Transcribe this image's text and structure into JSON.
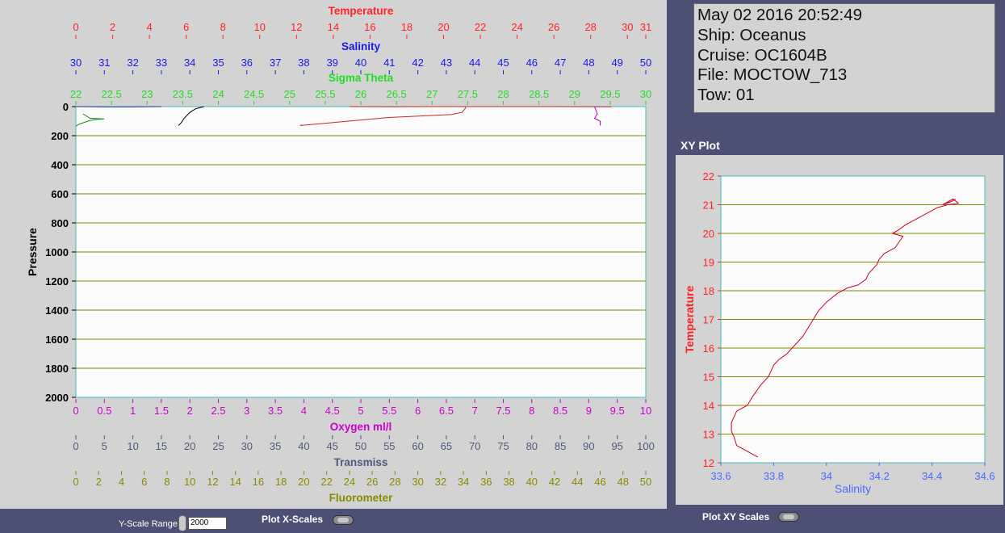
{
  "info": {
    "datetime": "May 02 2016 20:52:49",
    "ship": "Ship: Oceanus",
    "cruise": "Cruise: OC1604B",
    "file": "File: MOCTOW_713",
    "tow": "Tow: 01"
  },
  "xy_title": "XY Plot",
  "bottom": {
    "yscale_label": "Y-Scale Range",
    "yscale_value": "2000",
    "plot_xscales_label": "Plot X-Scales",
    "plot_xyscales_label": "Plot XY Scales"
  },
  "colors": {
    "temperature": "#ff2222",
    "salinity": "#1a1ae6",
    "sigma_theta": "#22dd22",
    "oxygen": "#cc00cc",
    "transmiss": "#505a78",
    "fluorometer": "#8a8a00",
    "xy_line": "#cc0022",
    "xy_salinity": "#4a6aff"
  },
  "chart_data": [
    {
      "type": "line",
      "ylabel": "Pressure",
      "ylim": [
        2000,
        0
      ],
      "yticks": [
        "0",
        "200",
        "400",
        "600",
        "800",
        "1000",
        "1200",
        "1400",
        "1600",
        "1800",
        "2000"
      ],
      "grid": true,
      "axes": {
        "temperature": {
          "label": "Temperature",
          "range": [
            0,
            31
          ],
          "ticks": [
            "0",
            "2",
            "4",
            "6",
            "8",
            "10",
            "12",
            "14",
            "16",
            "18",
            "20",
            "22",
            "24",
            "26",
            "28",
            "30",
            "31"
          ],
          "tick_values": [
            0,
            2,
            4,
            6,
            8,
            10,
            12,
            14,
            16,
            18,
            20,
            22,
            24,
            26,
            28,
            30,
            31
          ]
        },
        "salinity": {
          "label": "Salinity",
          "range": [
            30,
            50
          ],
          "ticks": [
            "30",
            "31",
            "32",
            "33",
            "34",
            "35",
            "36",
            "37",
            "38",
            "39",
            "40",
            "41",
            "42",
            "43",
            "44",
            "45",
            "46",
            "47",
            "48",
            "49",
            "50"
          ]
        },
        "sigma_theta": {
          "label": "Sigma Theta",
          "range": [
            22,
            30
          ],
          "ticks": [
            "22",
            "22.5",
            "23",
            "23.5",
            "24",
            "24.5",
            "25",
            "25.5",
            "26",
            "26.5",
            "27",
            "27.5",
            "28",
            "28.5",
            "29",
            "29.5",
            "30"
          ]
        },
        "oxygen": {
          "label": "Oxygen ml/l",
          "range": [
            0,
            10
          ],
          "ticks": [
            "0",
            "0.5",
            "1",
            "1.5",
            "2",
            "2.5",
            "3",
            "3.5",
            "4",
            "4.5",
            "5",
            "5.5",
            "6",
            "6.5",
            "7",
            "7.5",
            "8",
            "8.5",
            "9",
            "9.5",
            "10"
          ]
        },
        "transmiss": {
          "label": "Transmiss",
          "range": [
            0,
            100
          ],
          "ticks": [
            "0",
            "5",
            "10",
            "15",
            "20",
            "25",
            "30",
            "35",
            "40",
            "45",
            "50",
            "55",
            "60",
            "65",
            "70",
            "75",
            "80",
            "85",
            "90",
            "95",
            "100"
          ]
        },
        "fluorometer": {
          "label": "Fluorometer",
          "range": [
            0,
            50
          ],
          "ticks": [
            "0",
            "2",
            "4",
            "6",
            "8",
            "10",
            "12",
            "14",
            "16",
            "18",
            "20",
            "22",
            "24",
            "26",
            "28",
            "30",
            "32",
            "34",
            "36",
            "38",
            "40",
            "42",
            "44",
            "46",
            "48",
            "50"
          ]
        }
      },
      "series": [
        {
          "axis": "temperature",
          "points": [
            [
              21.2,
              0
            ],
            [
              21.2,
              10
            ],
            [
              21.0,
              40
            ],
            [
              20.4,
              55
            ],
            [
              17,
              75
            ],
            [
              12.2,
              130
            ],
            [
              12.3,
              126
            ]
          ]
        },
        {
          "axis": "salinity",
          "points": [
            [
              34.5,
              0
            ],
            [
              34.4,
              5
            ],
            [
              34.2,
              15
            ],
            [
              34.0,
              40
            ],
            [
              33.8,
              80
            ],
            [
              33.7,
              110
            ],
            [
              33.6,
              130
            ]
          ]
        },
        {
          "axis": "sigma_theta",
          "points": [
            [
              22.1,
              50
            ],
            [
              22.2,
              80
            ],
            [
              22.4,
              85
            ],
            [
              22.3,
              88
            ],
            [
              22.2,
              95
            ],
            [
              22.05,
              120
            ],
            [
              22.0,
              135
            ]
          ]
        },
        {
          "axis": "oxygen",
          "points": [
            [
              9.1,
              0
            ],
            [
              9.15,
              50
            ],
            [
              9.1,
              80
            ],
            [
              9.2,
              100
            ],
            [
              9.2,
              130
            ]
          ]
        },
        {
          "axis": "transmiss",
          "points": [
            [
              0,
              0
            ],
            [
              5,
              2
            ],
            [
              10,
              2
            ],
            [
              15,
              0
            ]
          ]
        },
        {
          "axis": "fluorometer",
          "points": [
            [
              24,
              0
            ],
            [
              28,
              1
            ],
            [
              30,
              0
            ],
            [
              38,
              0
            ],
            [
              42,
              0
            ],
            [
              47,
              1
            ]
          ]
        }
      ]
    },
    {
      "type": "line",
      "title": "XY Plot",
      "xlabel": "Salinity",
      "ylabel": "Temperature",
      "xlim": [
        33.6,
        34.6
      ],
      "ylim": [
        12,
        22
      ],
      "xticks": [
        "33.6",
        "33.8",
        "34",
        "34.2",
        "34.4",
        "34.6"
      ],
      "yticks": [
        "12",
        "13",
        "14",
        "15",
        "16",
        "17",
        "18",
        "19",
        "20",
        "21",
        "22"
      ],
      "grid": true,
      "x": [
        33.74,
        33.7,
        33.66,
        33.65,
        33.64,
        33.64,
        33.65,
        33.66,
        33.7,
        33.72,
        33.75,
        33.78,
        33.8,
        33.82,
        33.85,
        33.88,
        33.91,
        33.93,
        33.95,
        33.97,
        34.0,
        34.04,
        34.08,
        34.12,
        34.15,
        34.16,
        34.19,
        34.2,
        34.22,
        34.26,
        34.29,
        34.25,
        34.27,
        34.3,
        34.34,
        34.38,
        34.42,
        34.46,
        34.5,
        34.48,
        34.44,
        34.47,
        34.49
      ],
      "y": [
        12.2,
        12.4,
        12.6,
        12.9,
        13.1,
        13.4,
        13.6,
        13.8,
        14.0,
        14.3,
        14.7,
        15.0,
        15.4,
        15.6,
        15.8,
        16.1,
        16.4,
        16.7,
        17.0,
        17.3,
        17.6,
        17.9,
        18.1,
        18.2,
        18.4,
        18.6,
        18.9,
        19.1,
        19.3,
        19.5,
        19.9,
        20.0,
        20.1,
        20.3,
        20.5,
        20.7,
        20.9,
        21.0,
        21.05,
        21.2,
        21.0,
        21.1,
        21.2
      ]
    }
  ]
}
